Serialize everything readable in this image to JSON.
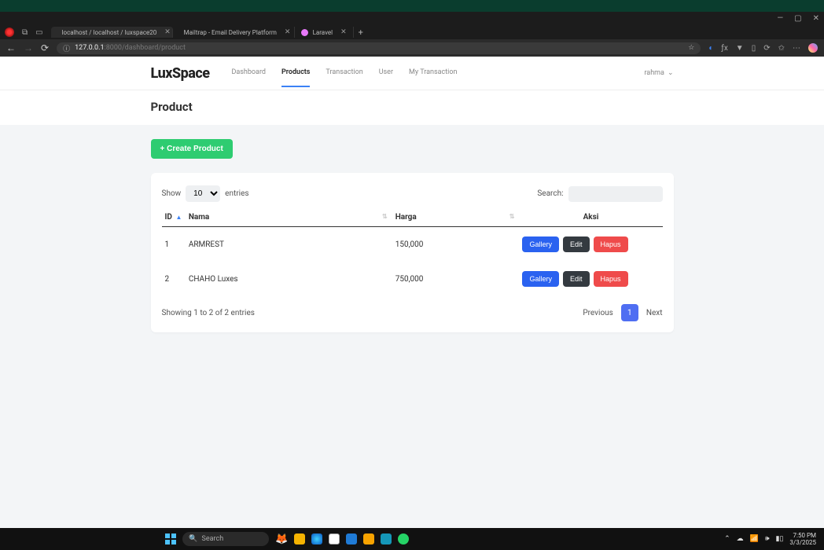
{
  "window": {
    "tabs": [
      {
        "label": "localhost / localhost / luxspace20",
        "favicon_bg": "#f97316"
      },
      {
        "label": "Mailtrap - Email Delivery Platform",
        "favicon_bg": "#16a34a"
      },
      {
        "label": "Laravel",
        "favicon_bg": "#e879f9"
      }
    ],
    "controls": {
      "min": "—",
      "max": "▢",
      "close": "✕"
    }
  },
  "address_bar": {
    "scheme_icon": "ⓘ",
    "host": "127.0.0.1",
    "port_path": ":8000/dashboard/product"
  },
  "browser_icons": {
    "star": "☆",
    "copilot": "◐",
    "fx": "ƒx",
    "vite": "▼",
    "mobile": "▯",
    "refresh_ext": "⟳",
    "collections": "✩",
    "more": "⋯"
  },
  "nav": {
    "logo": "LuxSpace",
    "items": [
      {
        "label": "Dashboard",
        "active": false
      },
      {
        "label": "Products",
        "active": true
      },
      {
        "label": "Transaction",
        "active": false
      },
      {
        "label": "User",
        "active": false
      },
      {
        "label": "My Transaction",
        "active": false
      }
    ],
    "user_name": "rahma",
    "chevron": "⌄"
  },
  "page_title": "Product",
  "buttons": {
    "create": "+ Create Product",
    "gallery": "Gallery",
    "edit": "Edit",
    "hapus": "Hapus"
  },
  "datatable": {
    "show_label_pre": "Show",
    "show_value": "10",
    "show_label_post": "entries",
    "search_label": "Search:",
    "columns": {
      "id": "ID",
      "nama": "Nama",
      "harga": "Harga",
      "aksi": "Aksi"
    },
    "rows": [
      {
        "id": "1",
        "nama": "ARMREST",
        "harga": "150,000"
      },
      {
        "id": "2",
        "nama": "CHAHO Luxes",
        "harga": "750,000"
      }
    ],
    "footer_info": "Showing 1 to 2 of 2 entries",
    "pagination": {
      "prev": "Previous",
      "page": "1",
      "next": "Next"
    }
  },
  "taskbar": {
    "search_placeholder": "Search",
    "time": "7:50 PM",
    "date": "3/3/2025",
    "tray": {
      "chevron": "⌃",
      "wifi": "◇",
      "vol": "🕪",
      "battery": "▮▯"
    }
  }
}
